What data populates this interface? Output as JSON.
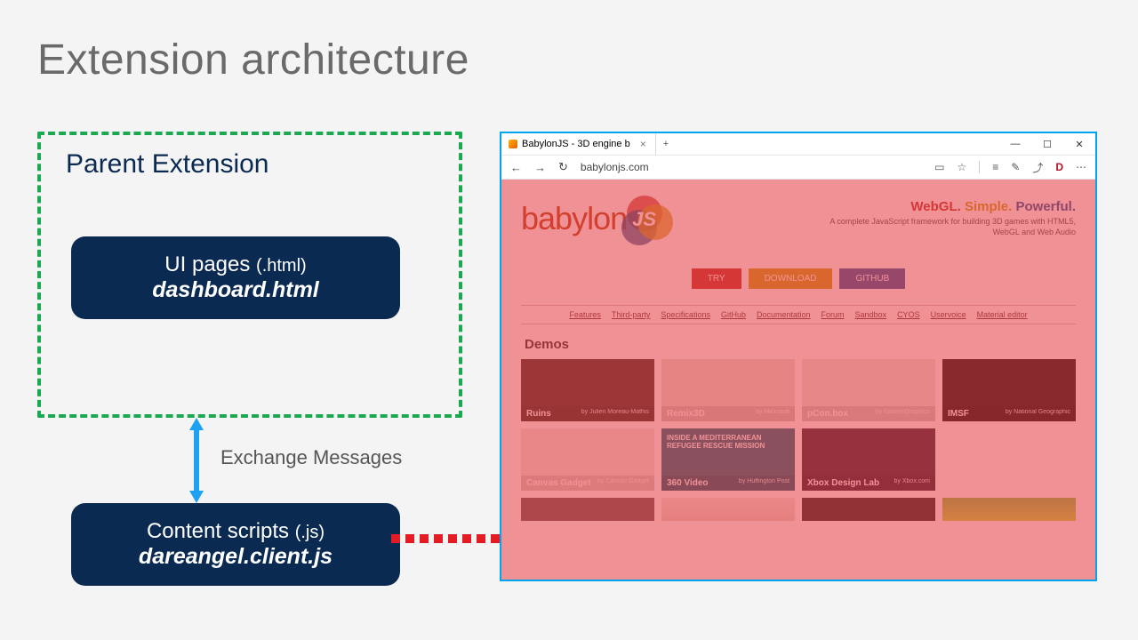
{
  "title": "Extension architecture",
  "parent_label": "Parent Extension",
  "ui_box": {
    "line1": "UI pages ",
    "paren": "(.html)",
    "line2": "dashboard.html"
  },
  "content_box": {
    "line1": "Content scripts ",
    "paren": "(.js)",
    "line2": "dareangel.client.js"
  },
  "exchange": "Exchange Messages",
  "browser": {
    "tab_title": "BabylonJS - 3D engine b",
    "tab_close": "×",
    "tab_plus": "+",
    "win_min": "—",
    "win_max": "☐",
    "win_close": "✕",
    "back": "←",
    "forward": "→",
    "refresh": "↻",
    "url": "babylonjs.com",
    "icons": {
      "book": "▭",
      "star": "☆",
      "menu": "≡",
      "edit": "✎",
      "share": "⤴",
      "d": "D",
      "more": "⋯"
    }
  },
  "page": {
    "logo_text": "babylon",
    "js_text": "JS",
    "tagline_parts": {
      "w1": "WebGL.",
      "w2": "Simple.",
      "w3": "Powerful."
    },
    "tagline_sub": "A complete JavaScript framework for building 3D games with HTML5, WebGL and Web Audio",
    "buttons": {
      "try": "TRY",
      "download": "DOWNLOAD",
      "github": "GITHUB"
    },
    "nav": [
      "Features",
      "Third-party",
      "Specifications",
      "GitHub",
      "Documentation",
      "Forum",
      "Sandbox",
      "CYOS",
      "Uservoice",
      "Material editor"
    ],
    "demos_title": "Demos",
    "cards": [
      {
        "name": "Ruins",
        "by": "by Julien Moreau-Mathis",
        "bg": "#47382f"
      },
      {
        "name": "Remix3D",
        "by": "by Microsoft",
        "bg": "#e9e2da"
      },
      {
        "name": "pCon.box",
        "by": "by EasternGraphics",
        "bg": "#ece8e1"
      },
      {
        "name": "",
        "by": "",
        "bg": "#d8d0c6"
      },
      {
        "name": "IMSF",
        "by": "by National Geographic",
        "bg": "#1a1a1a"
      },
      {
        "name": "Canvas Gadget",
        "by": "by Canvas Gadget",
        "bg": "#efe9e2"
      },
      {
        "name": "360 Video",
        "by": "by Huffington Post",
        "bg": "#1f6f86",
        "caption_inside": "INSIDE A MEDITERRANEAN REFUGEE RESCUE MISSION"
      },
      {
        "name": "Xbox Design Lab",
        "by": "by Xbox.com",
        "bg": "#3a2a3e"
      }
    ]
  }
}
